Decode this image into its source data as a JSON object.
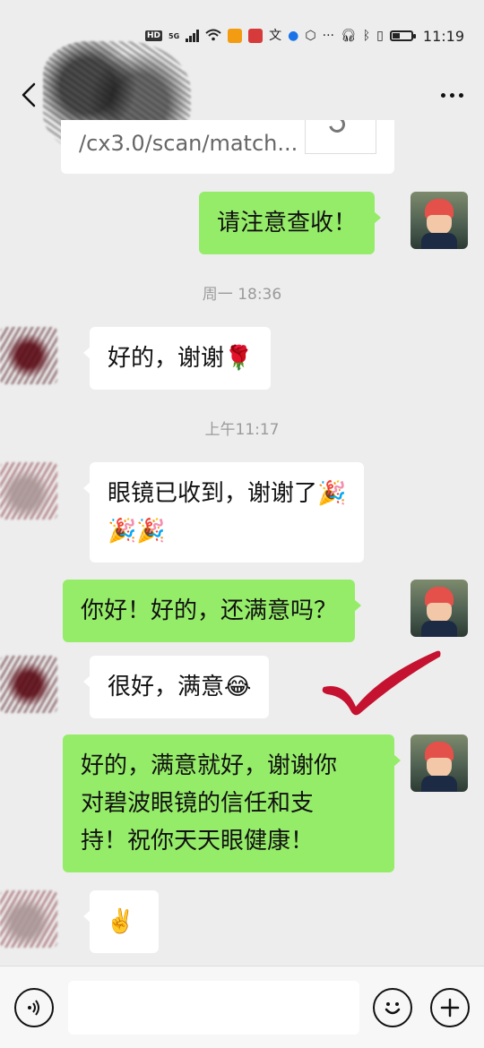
{
  "status_bar": {
    "time": "11:19",
    "network_label": "HD",
    "network_gen": "5G",
    "icons": [
      "hd-icon",
      "signal-icon",
      "wifi-icon",
      "app-notification-icon",
      "app-notification-icon",
      "translate-icon",
      "browser-icon",
      "shield-icon",
      "more-dots",
      "headphone-icon",
      "bluetooth-icon",
      "vibrate-icon",
      "battery-icon"
    ]
  },
  "nav": {
    "back_icon": "chevron-left-icon",
    "more_icon": "more-horizontal-icon"
  },
  "messages": {
    "link_card_text": "/cx3.0/scan/match...",
    "m1": "请注意查收！",
    "time1": "周一 18:36",
    "m2": "好的，谢谢🌹",
    "time2": "上午11:17",
    "m3": "眼镜已收到，谢谢了🎉\n🎉🎉",
    "m4": "你好！好的，还满意吗？",
    "m5": "很好，满意😂",
    "m6": "好的，满意就好，谢谢你\n对碧波眼镜的信任和支\n持！祝你天天眼健康！",
    "m7": "✌️"
  },
  "input_bar": {
    "voice_icon": "voice-icon",
    "emoji_icon": "emoji-icon",
    "plus_icon": "plus-icon",
    "placeholder": ""
  },
  "colors": {
    "background": "#ededed",
    "bubble_self": "#95ec69",
    "bubble_other": "#ffffff",
    "timestamp": "#9a9a9a",
    "check_mark": "#c41230"
  }
}
